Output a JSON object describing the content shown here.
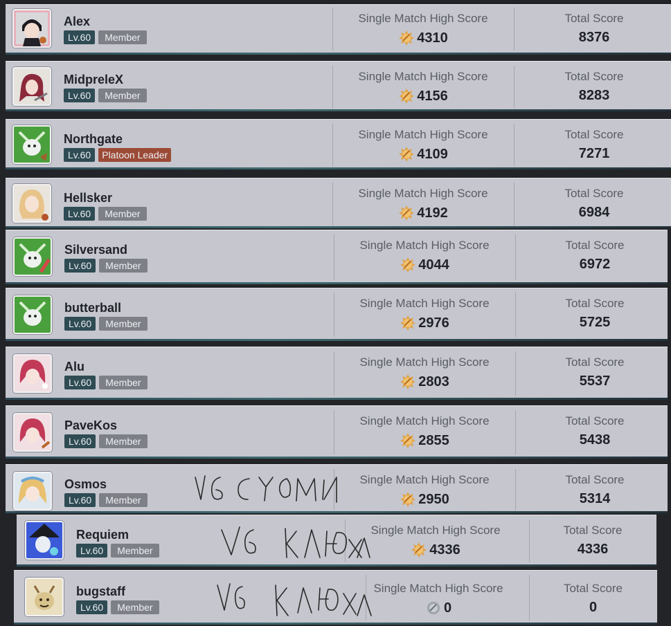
{
  "labels": {
    "single_match": "Single Match High Score",
    "total": "Total Score"
  },
  "colors": {
    "row_bg": "#c5c6ce",
    "level_badge": "#2f4b54",
    "member_badge": "#7e8088",
    "leader_badge": "#9b4a36",
    "medal_gold": "#e0a449",
    "medal_silver": "#9ea4aa"
  },
  "players": [
    {
      "name": "Alex",
      "level": "Lv.60",
      "role": "Member",
      "high_score": "4310",
      "total_score": "8376",
      "medal": "gold-medal-icon",
      "avatar": "avatar-dark-hair-boy"
    },
    {
      "name": "MidpreleX",
      "level": "Lv.60",
      "role": "Member",
      "high_score": "4156",
      "total_score": "8283",
      "medal": "gold-medal-icon",
      "avatar": "avatar-red-hair-girl"
    },
    {
      "name": "Northgate",
      "level": "Lv.60",
      "role": "Platoon Leader",
      "high_score": "4109",
      "total_score": "7271",
      "medal": "gold-medal-icon",
      "avatar": "avatar-green-creature"
    },
    {
      "name": "Hellsker",
      "level": "Lv.60",
      "role": "Member",
      "high_score": "4192",
      "total_score": "6984",
      "medal": "gold-medal-icon",
      "avatar": "avatar-blonde-girl"
    },
    {
      "name": "Silversand",
      "level": "Lv.60",
      "role": "Member",
      "high_score": "4044",
      "total_score": "6972",
      "medal": "gold-medal-icon",
      "avatar": "avatar-green-creature"
    },
    {
      "name": "butterball",
      "level": "Lv.60",
      "role": "Member",
      "high_score": "2976",
      "total_score": "5725",
      "medal": "gold-medal-icon",
      "avatar": "avatar-green-creature"
    },
    {
      "name": "Alu",
      "level": "Lv.60",
      "role": "Member",
      "high_score": "2803",
      "total_score": "5537",
      "medal": "gold-medal-icon",
      "avatar": "avatar-pink-hair-girl"
    },
    {
      "name": "PaveKos",
      "level": "Lv.60",
      "role": "Member",
      "high_score": "2855",
      "total_score": "5438",
      "medal": "gold-medal-icon",
      "avatar": "avatar-pink-hair-girl"
    },
    {
      "name": "Osmos",
      "level": "Lv.60",
      "role": "Member",
      "high_score": "2950",
      "total_score": "5314",
      "medal": "gold-medal-icon",
      "avatar": "avatar-blonde-blue-girl"
    },
    {
      "name": "Requiem",
      "level": "Lv.60",
      "role": "Member",
      "high_score": "4336",
      "total_score": "4336",
      "medal": "gold-medal-icon",
      "avatar": "avatar-witch-hat"
    },
    {
      "name": "bugstaff",
      "level": "Lv.60",
      "role": "Member",
      "high_score": "0",
      "total_score": "0",
      "medal": "silver-medal-icon",
      "avatar": "avatar-doodle-creature"
    }
  ],
  "annotations": [
    {
      "text": "V6 CYOMN"
    },
    {
      "text": "V6 KANOXA"
    },
    {
      "text": "V6 KANOXA"
    }
  ]
}
